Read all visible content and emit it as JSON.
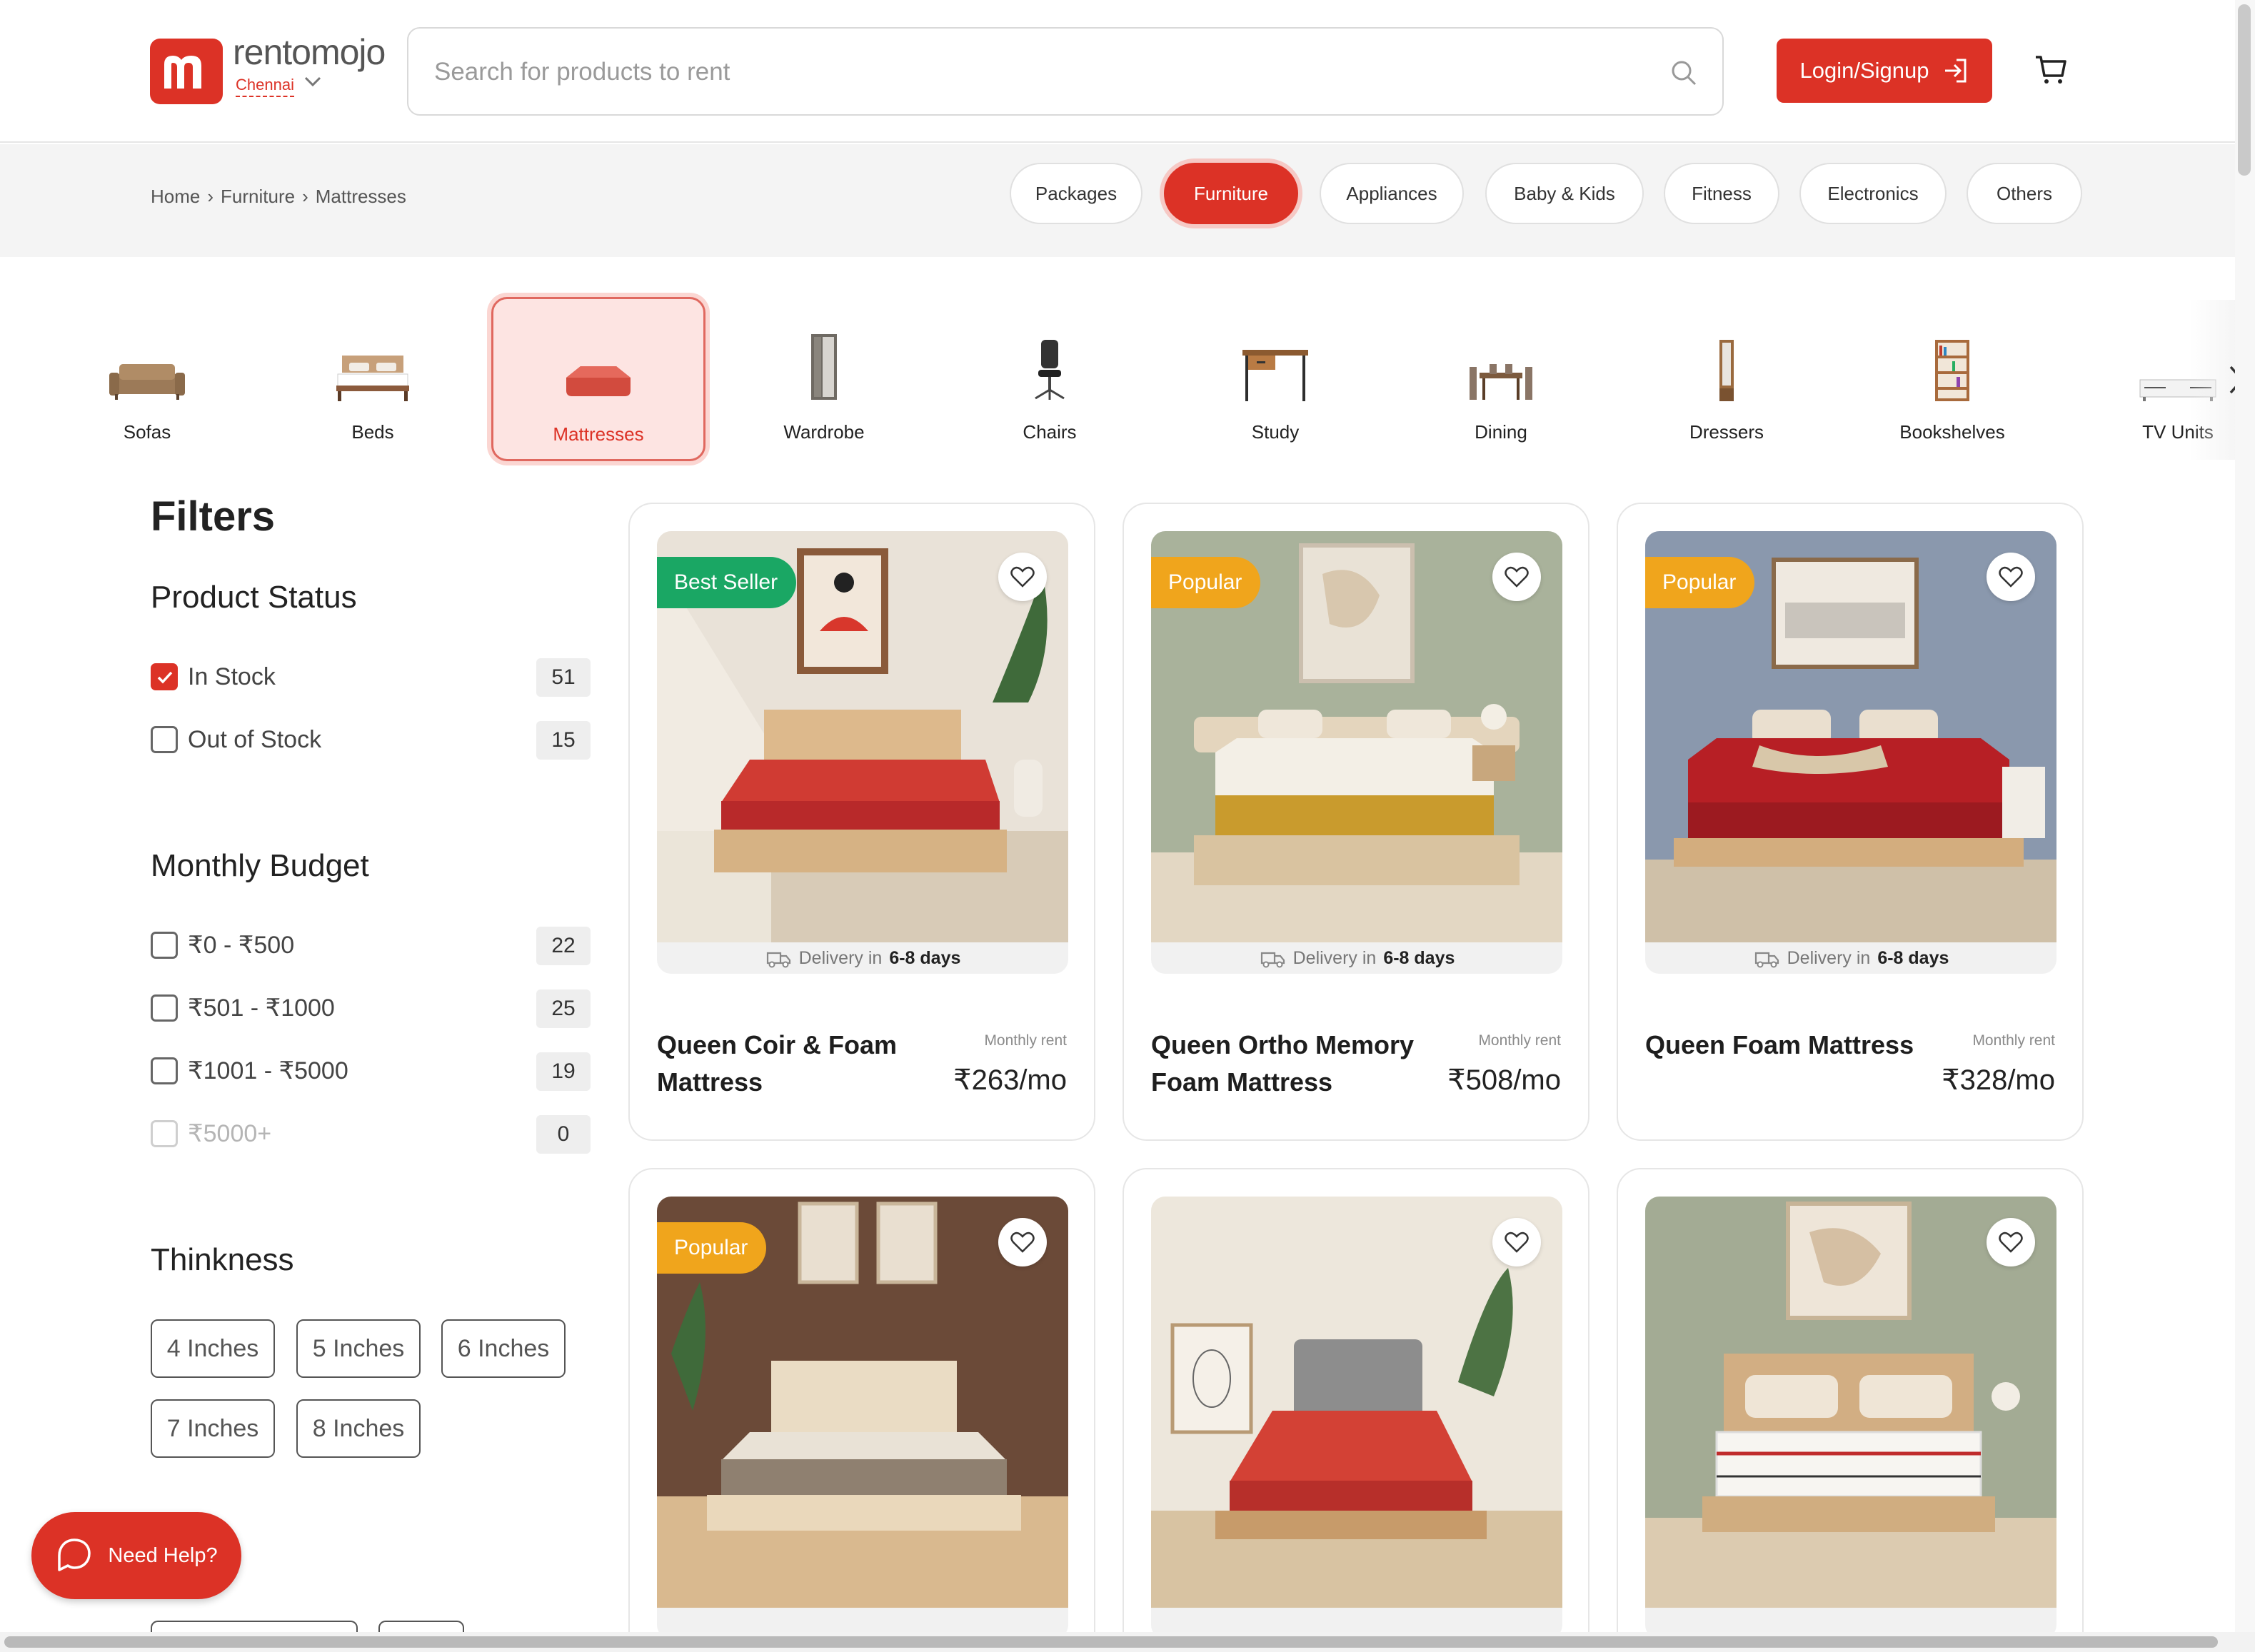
{
  "header": {
    "brand": "rentomojo",
    "city": "Chennai",
    "search_placeholder": "Search for products to rent",
    "login_label": "Login/Signup"
  },
  "breadcrumb": [
    "Home",
    "Furniture",
    "Mattresses"
  ],
  "categories": [
    "Packages",
    "Furniture",
    "Appliances",
    "Baby & Kids",
    "Fitness",
    "Electronics",
    "Others"
  ],
  "active_category": "Furniture",
  "subcategories": [
    "Sofas",
    "Beds",
    "Mattresses",
    "Wardrobe",
    "Chairs",
    "Study",
    "Dining",
    "Dressers",
    "Bookshelves",
    "TV Units"
  ],
  "active_subcategory": "Mattresses",
  "filters": {
    "title": "Filters",
    "product_status": {
      "title": "Product Status",
      "options": [
        {
          "label": "In Stock",
          "count": "51",
          "checked": true
        },
        {
          "label": "Out of Stock",
          "count": "15",
          "checked": false
        }
      ]
    },
    "monthly_budget": {
      "title": "Monthly Budget",
      "options": [
        {
          "label": "₹0 - ₹500",
          "count": "22"
        },
        {
          "label": "₹501 - ₹1000",
          "count": "25"
        },
        {
          "label": "₹1001 - ₹5000",
          "count": "19"
        },
        {
          "label": "₹5000+",
          "count": "0",
          "disabled": true
        }
      ]
    },
    "thickness": {
      "title": "Thinkness",
      "options": [
        "4 Inches",
        "5 Inches",
        "6 Inches",
        "7 Inches",
        "8 Inches"
      ]
    }
  },
  "products": [
    {
      "name": "Queen Coir & Foam Mattress",
      "tag": "Best Seller",
      "tag_color": "#1aa764",
      "delivery_prefix": "Delivery in",
      "delivery_days": "6-8 days",
      "rent_label": "Monthly rent",
      "price": "₹263",
      "per": "/mo"
    },
    {
      "name": "Queen Ortho Memory Foam Mattress",
      "tag": "Popular",
      "tag_color": "#f0a51c",
      "delivery_prefix": "Delivery in",
      "delivery_days": "6-8 days",
      "rent_label": "Monthly rent",
      "price": "₹508",
      "per": "/mo"
    },
    {
      "name": "Queen Foam Mattress",
      "tag": "Popular",
      "tag_color": "#f0a51c",
      "delivery_prefix": "Delivery in",
      "delivery_days": "6-8 days",
      "rent_label": "Monthly rent",
      "price": "₹328",
      "per": "/mo"
    },
    {
      "tag": "Popular",
      "tag_color": "#f0a51c"
    },
    {},
    {}
  ],
  "help_label": "Need Help?",
  "colors": {
    "brand": "#dc3226",
    "best_seller": "#1aa764",
    "popular": "#f0a51c"
  }
}
